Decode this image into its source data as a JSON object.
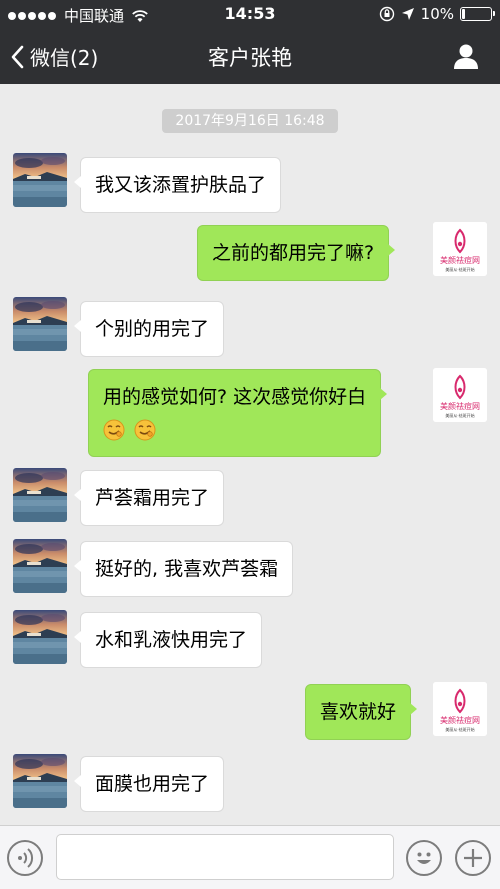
{
  "status_bar": {
    "carrier": "中国联通",
    "time": "14:53",
    "battery": "10%",
    "battery_level": 0.1,
    "signal_bars": 5,
    "icons": [
      "wifi-icon",
      "orientation-lock-icon",
      "location-arrow-icon",
      "battery-icon"
    ]
  },
  "nav": {
    "back_label": "微信(2)",
    "title": "客户张艳",
    "profile_icon": "person-icon"
  },
  "chat": {
    "timestamp": "2017年9月16日 16:48",
    "contact_avatar": "landscape-sunset-avatar",
    "self_avatar_text": "美颜祛痘网",
    "self_avatar_subtext": "美丽从·祛斑开始",
    "messages": [
      {
        "side": "left",
        "text": "我又该添置护肤品了"
      },
      {
        "side": "right",
        "text": "之前的都用完了嘛?"
      },
      {
        "side": "left",
        "text": "个别的用完了"
      },
      {
        "side": "right",
        "text": "用的感觉如何? 这次感觉你好白",
        "emojis": [
          "smirk-emoji",
          "smirk-emoji"
        ]
      },
      {
        "side": "left",
        "text": "芦荟霜用完了"
      },
      {
        "side": "left",
        "text": "挺好的, 我喜欢芦荟霜"
      },
      {
        "side": "left",
        "text": "水和乳液快用完了"
      },
      {
        "side": "right",
        "text": "喜欢就好"
      },
      {
        "side": "left",
        "text": "面膜也用完了"
      }
    ]
  },
  "input_bar": {
    "value": "",
    "icons": [
      "voice-icon",
      "emoji-face-icon",
      "plus-icon"
    ]
  }
}
